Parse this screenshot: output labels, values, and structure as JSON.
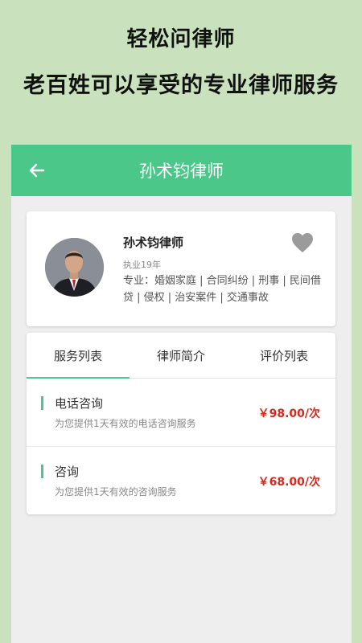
{
  "promo": {
    "title": "轻松问律师",
    "subtitle": "老百姓可以享受的专业律师服务"
  },
  "appbar": {
    "back_icon": "arrow-left-icon",
    "title": "孙术钧律师"
  },
  "profile": {
    "name": "孙术钧律师",
    "years": "执业19年",
    "specialty": "专业：婚姻家庭 | 合同纠纷 | 刑事 | 民间借贷 | 侵权 | 治安案件 | 交通事故",
    "favorite_icon": "heart-icon"
  },
  "tabs": [
    {
      "label": "服务列表",
      "active": true
    },
    {
      "label": "律师简介",
      "active": false
    },
    {
      "label": "评价列表",
      "active": false
    }
  ],
  "services": [
    {
      "title": "电话咨询",
      "desc": "为您提供1天有效的电话咨询服务",
      "price": "￥98.00/次"
    },
    {
      "title": "咨询",
      "desc": "为您提供1天有效的咨询服务",
      "price": "￥68.00/次"
    }
  ],
  "colors": {
    "background": "#c9e2bd",
    "accent": "#4cc78a",
    "price": "#d42a1e"
  }
}
